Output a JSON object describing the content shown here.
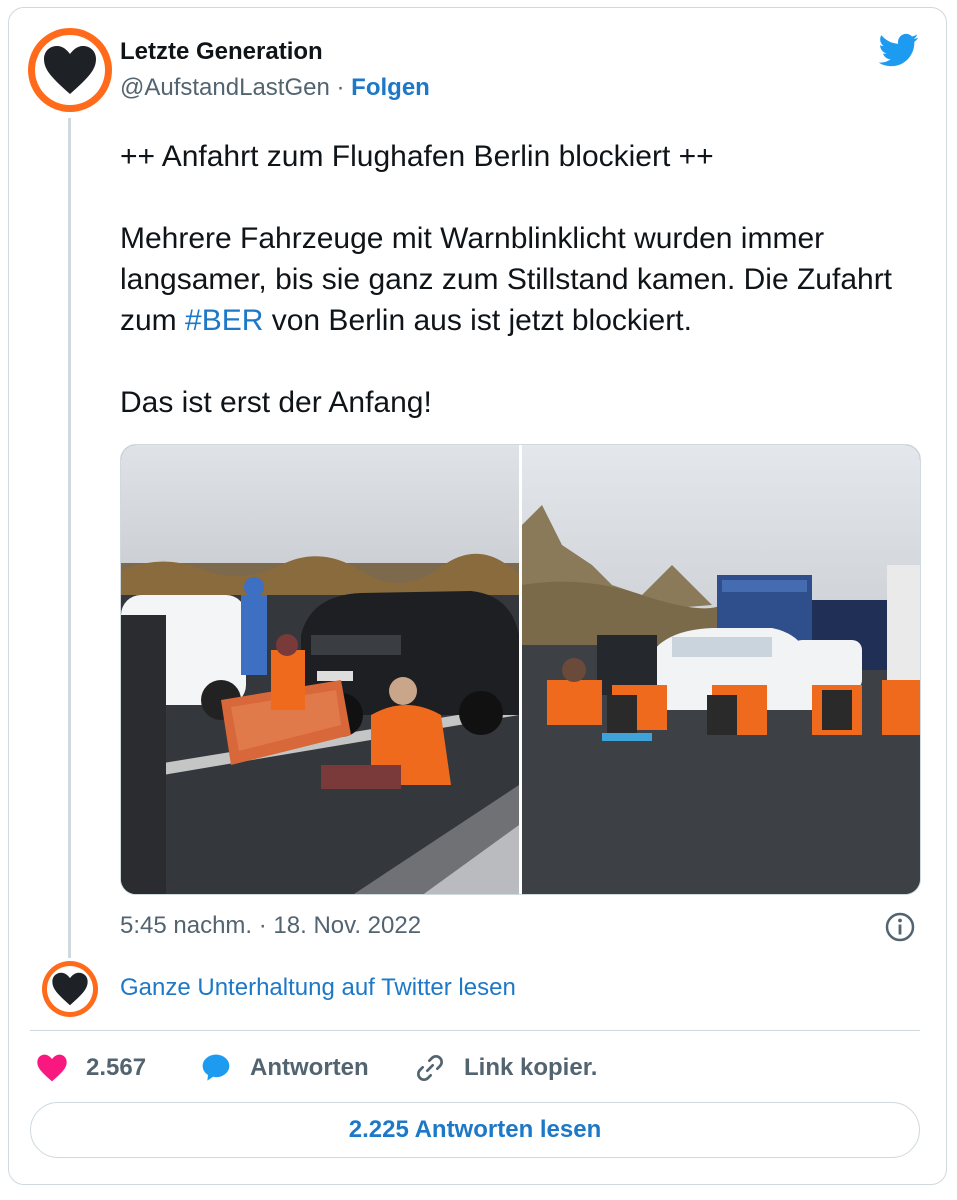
{
  "tweet": {
    "author_name": "Letzte Generation",
    "author_handle": "@AufstandLastGen",
    "separator": "·",
    "follow_label": "Folgen",
    "headline": "++ Anfahrt zum Flughafen Berlin blockiert ++",
    "paragraph2_part1": "Mehrere Fahrzeuge mit Warnblinklicht wurden immer langsamer, bis sie ganz zum Stillstand kamen. Die Zufahrt zum ",
    "hashtag": "#BER",
    "paragraph2_part2": " von Berlin aus ist jetzt blockiert.",
    "paragraph3": "Das ist erst der Anfang!",
    "timestamp": "5:45 nachm. · 18. Nov. 2022",
    "read_conversation": "Ganze Unterhaltung auf Twitter lesen",
    "likes_count": "2.567",
    "reply_label": "Antworten",
    "copy_link_label": "Link kopier.",
    "read_replies_label": "2.225 Antworten lesen"
  },
  "colors": {
    "brand_orange": "#ff6b1a",
    "link_blue": "#1d78c8",
    "like_pink": "#f91880",
    "twitter_blue": "#1d9bf0",
    "text_gray": "#536471",
    "border": "#cfd9de"
  },
  "icons": {
    "logo": "heart-logo-icon",
    "brand": "twitter-bird-icon",
    "info": "info-icon",
    "like": "heart-icon",
    "reply": "speech-bubble-icon",
    "link": "chain-link-icon"
  }
}
